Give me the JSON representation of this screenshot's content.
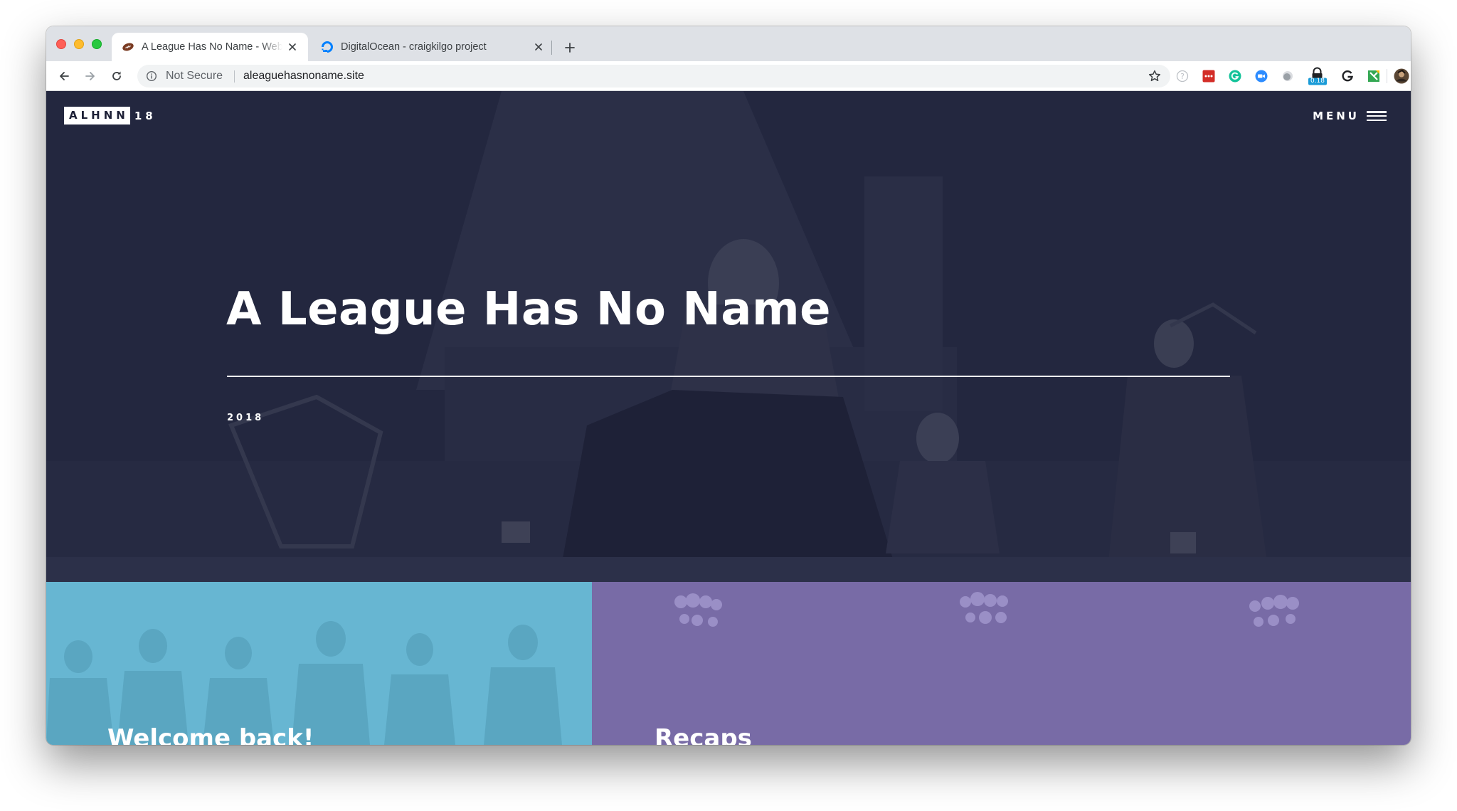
{
  "browser": {
    "tabs": [
      {
        "title": "A League Has No Name - Website",
        "favicon": "football-icon",
        "active": true
      },
      {
        "title": "DigitalOcean - craigkilgo project",
        "favicon": "digitalocean-icon",
        "active": false
      }
    ],
    "address": {
      "security_label": "Not Secure",
      "url": "aleaguehasnoname.site"
    },
    "extensions": [
      {
        "name": "help-extension-icon",
        "color": "#9aa0a6"
      },
      {
        "name": "lastpass-extension-icon",
        "color": "#d32d27"
      },
      {
        "name": "grammarly-extension-icon",
        "color": "#15c39a"
      },
      {
        "name": "zoom-extension-icon",
        "color": "#2d8cff"
      },
      {
        "name": "gray-circle-extension-icon",
        "color": "#9aa0a6"
      },
      {
        "name": "lock-extension-icon",
        "color": "#202124",
        "badge": "0.18"
      },
      {
        "name": "g-extension-icon",
        "color": "#202124"
      },
      {
        "name": "green-extension-icon",
        "color": "#34a853"
      },
      {
        "name": "profile-avatar",
        "color": "#5a4634"
      }
    ]
  },
  "site": {
    "brand_box": "ALHNN",
    "brand_num": "18",
    "menu_label": "MENU",
    "hero_title": "A League Has No Name",
    "hero_year": "2018",
    "tiles": [
      {
        "title": "Welcome back!",
        "color": "#67b6d2"
      },
      {
        "title": "Recaps",
        "color": "#786ba6"
      }
    ]
  },
  "colors": {
    "hero_bg": "#23273f",
    "welcome_tile": "#67b6d2",
    "recaps_tile": "#786ba6"
  }
}
